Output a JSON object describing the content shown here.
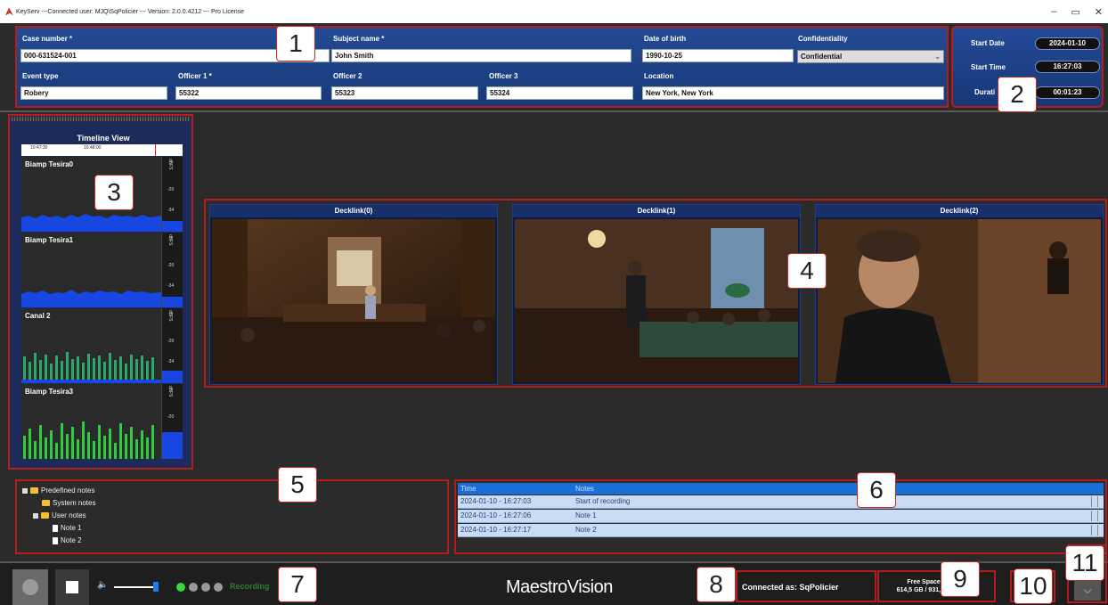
{
  "window": {
    "title": "KeyServ ---Connected user: MJQ\\SqPolicier --- Version: 2.0.0.4212 --- Pro License",
    "minimize": "–",
    "maximize": "▭",
    "close": "✕"
  },
  "callouts": [
    "1",
    "2",
    "3",
    "4",
    "5",
    "6",
    "7",
    "8",
    "9",
    "10",
    "11"
  ],
  "case": {
    "case_number_label": "Case number *",
    "case_number": "000-631524-001",
    "subject_name_label": "Subject name *",
    "subject_name": "John Smith",
    "dob_label": "Date of birth",
    "dob": "1990-10-25",
    "confidentiality_label": "Confidentiality",
    "confidentiality": "Confidential",
    "event_type_label": "Event type",
    "event_type": "Robery",
    "officer1_label": "Officer 1 *",
    "officer1": "55322",
    "officer2_label": "Officer 2",
    "officer2": "55323",
    "officer3_label": "Officer 3",
    "officer3": "55324",
    "location_label": "Location",
    "location": "New York, New York"
  },
  "datetime": {
    "start_date_label": "Start Date",
    "start_date": "2024-01-10",
    "start_time_label": "Start Time",
    "start_time": "16:27:03",
    "duration_label": "Durati",
    "duration": "00:01:23"
  },
  "timeline": {
    "title": "Timeline View",
    "ticks": [
      "10:47:30",
      "10:48:00"
    ],
    "channels": [
      {
        "name": "Biamp Tesira0",
        "color": "#1746e0"
      },
      {
        "name": "Biamp Tesira1",
        "color": "#1746e0"
      },
      {
        "name": "Canal 2",
        "color": "#2ba86a"
      },
      {
        "name": "Biamp Tesira3",
        "color": "#2ecc40"
      }
    ],
    "db_labels": [
      "-20",
      "-34"
    ],
    "unit": "dBFS"
  },
  "video": {
    "feeds": [
      "Decklink(0)",
      "Decklink(1)",
      "Decklink(2)"
    ]
  },
  "notes_tree": {
    "root": "Predefined notes",
    "system": "System notes",
    "user": "User notes",
    "items": [
      "Note 1",
      "Note 2"
    ]
  },
  "notes_table": {
    "headers": [
      "Time",
      "Notes"
    ],
    "rows": [
      {
        "time": "2024-01-10 - 16:27:03",
        "note": "Start of recording"
      },
      {
        "time": "2024-01-10 - 16:27:06",
        "note": "Note 1"
      },
      {
        "time": "2024-01-10 - 16:27:17",
        "note": "Note 2"
      }
    ]
  },
  "bottom": {
    "recording_label": "Recording",
    "logo": "MaestroVision",
    "connected": "Connected as: SqPolicier",
    "free_space_label": "Free Space",
    "free_space": "614,5 GB / 931,5 G"
  }
}
